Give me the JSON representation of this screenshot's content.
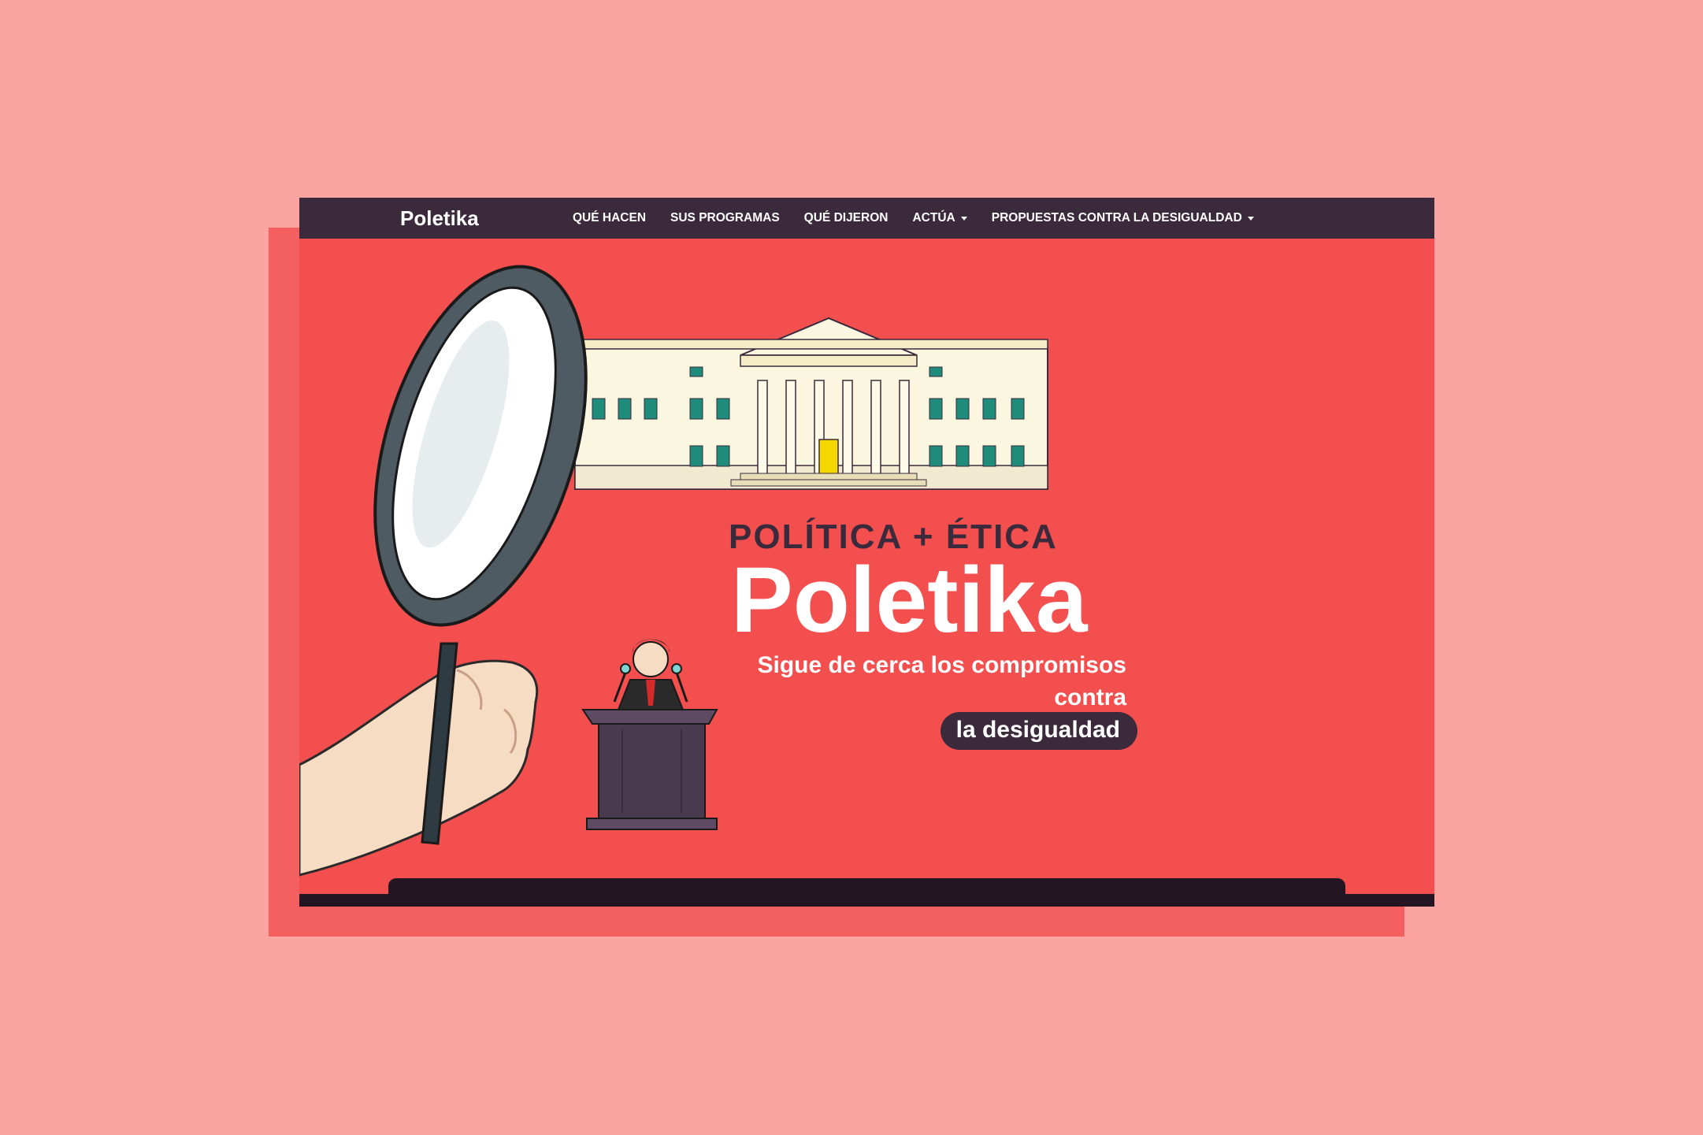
{
  "nav": {
    "brand": "Poletika",
    "items": [
      {
        "label": "QUÉ HACEN",
        "has_dropdown": false
      },
      {
        "label": "SUS PROGRAMAS",
        "has_dropdown": false
      },
      {
        "label": "QUÉ DIJERON",
        "has_dropdown": false
      },
      {
        "label": "ACTÚA",
        "has_dropdown": true
      },
      {
        "label": "PROPUESTAS CONTRA LA DESIGUALDAD",
        "has_dropdown": true
      }
    ]
  },
  "hero": {
    "kicker": "POLÍTICA + ÉTICA",
    "title": "Poletika",
    "subtitle_line1": "Sigue de cerca los compromisos",
    "subtitle_line2": "contra",
    "highlight": "la desigualdad"
  },
  "icons": {
    "magnifier": "magnifying-glass-icon",
    "building": "parliament-building-icon",
    "speaker": "politician-podium-icon",
    "hand": "hand-icon"
  },
  "colors": {
    "background": "#fba4a2",
    "shadow_card": "#f45f5f",
    "hero_bg": "#f44f4f",
    "navbar": "#3a2a3b",
    "dark": "#231522",
    "text_light": "#ffffff"
  }
}
